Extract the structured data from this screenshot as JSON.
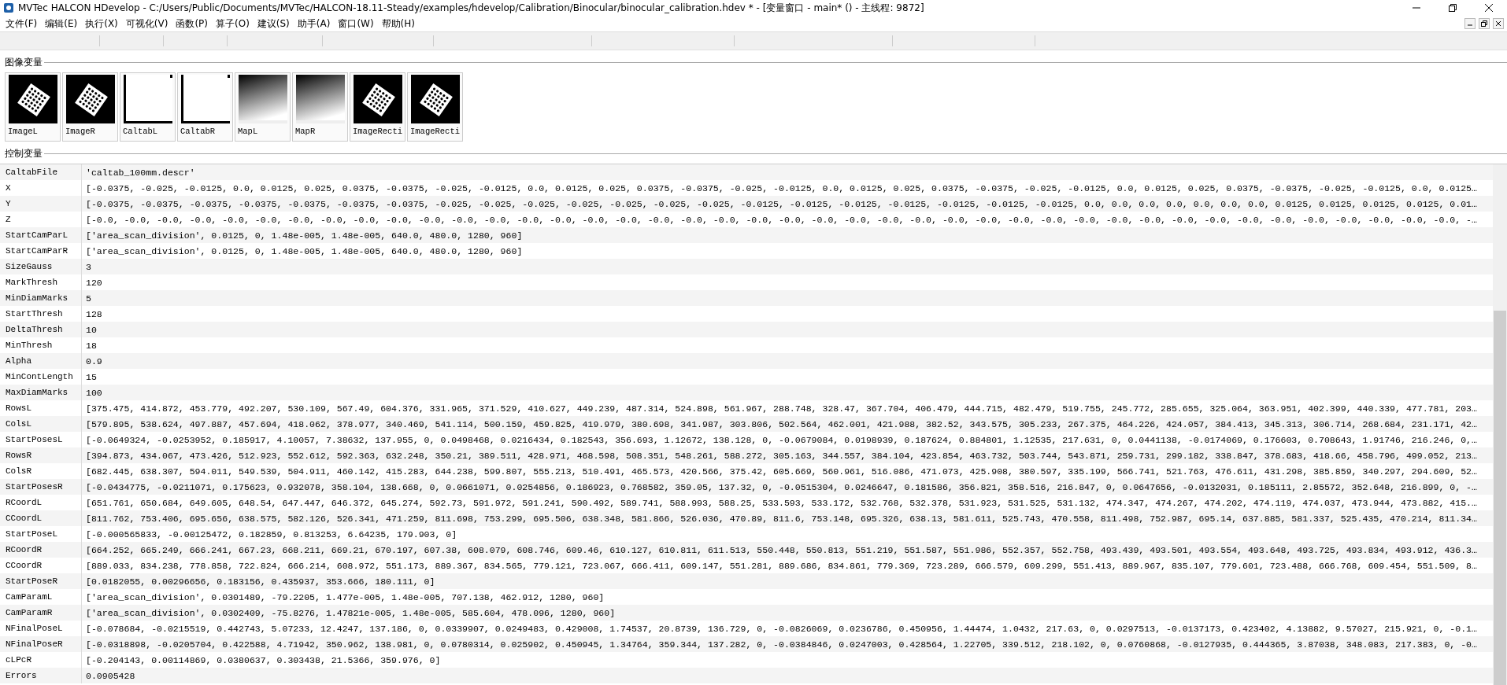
{
  "window": {
    "title": "MVTec HALCON HDevelop - C:/Users/Public/Documents/MVTec/HALCON-18.11-Steady/examples/hdevelop/Calibration/Binocular/binocular_calibration.hdev * - [变量窗口 - main* () - 主线程: 9872]"
  },
  "menu": [
    "文件(F)",
    "编辑(E)",
    "执行(X)",
    "可视化(V)",
    "函数(P)",
    "算子(O)",
    "建议(S)",
    "助手(A)",
    "窗口(W)",
    "帮助(H)"
  ],
  "image_variables": {
    "title": "图像变量",
    "items": [
      {
        "name": "ImageL",
        "kind": "plate"
      },
      {
        "name": "ImageR",
        "kind": "plate"
      },
      {
        "name": "CaltabL",
        "kind": "blank"
      },
      {
        "name": "CaltabR",
        "kind": "blank"
      },
      {
        "name": "MapL",
        "kind": "gradient"
      },
      {
        "name": "MapR",
        "kind": "gradient"
      },
      {
        "name": "ImageRecti",
        "kind": "plate"
      },
      {
        "name": "ImageRecti",
        "kind": "plate"
      }
    ]
  },
  "control_variables": {
    "title": "控制变量",
    "rows": [
      {
        "name": "CaltabFile",
        "value": "'caltab_100mm.descr'"
      },
      {
        "name": "X",
        "value": "[-0.0375, -0.025, -0.0125, 0.0, 0.0125, 0.025, 0.0375, -0.0375, -0.025, -0.0125, 0.0, 0.0125, 0.025, 0.0375, -0.0375, -0.025, -0.0125, 0.0, 0.0125, 0.025, 0.0375, -0.0375, -0.025, -0.0125, 0.0, 0.0125, 0.025, 0.0375, -0.0375, -0.025, -0.0125, 0.0, 0.0125…"
      },
      {
        "name": "Y",
        "value": "[-0.0375, -0.0375, -0.0375, -0.0375, -0.0375, -0.0375, -0.0375, -0.025, -0.025, -0.025, -0.025, -0.025, -0.025, -0.025, -0.0125, -0.0125, -0.0125, -0.0125, -0.0125, -0.0125, -0.0125, 0.0, 0.0, 0.0, 0.0, 0.0, 0.0, 0.0, 0.0125, 0.0125, 0.0125, 0.0125, 0.01…"
      },
      {
        "name": "Z",
        "value": "[-0.0, -0.0, -0.0, -0.0, -0.0, -0.0, -0.0, -0.0, -0.0, -0.0, -0.0, -0.0, -0.0, -0.0, -0.0, -0.0, -0.0, -0.0, -0.0, -0.0, -0.0, -0.0, -0.0, -0.0, -0.0, -0.0, -0.0, -0.0, -0.0, -0.0, -0.0, -0.0, -0.0, -0.0, -0.0, -0.0, -0.0, -0.0, -0.0, -0.0, -0.0, -0.0, -…"
      },
      {
        "name": "StartCamParL",
        "value": "['area_scan_division', 0.0125, 0, 1.48e-005, 1.48e-005, 640.0, 480.0, 1280, 960]"
      },
      {
        "name": "StartCamParR",
        "value": "['area_scan_division', 0.0125, 0, 1.48e-005, 1.48e-005, 640.0, 480.0, 1280, 960]"
      },
      {
        "name": "SizeGauss",
        "value": "3"
      },
      {
        "name": "MarkThresh",
        "value": "120"
      },
      {
        "name": "MinDiamMarks",
        "value": "5"
      },
      {
        "name": "StartThresh",
        "value": "128"
      },
      {
        "name": "DeltaThresh",
        "value": "10"
      },
      {
        "name": "MinThresh",
        "value": "18"
      },
      {
        "name": "Alpha",
        "value": "0.9"
      },
      {
        "name": "MinContLength",
        "value": "15"
      },
      {
        "name": "MaxDiamMarks",
        "value": "100"
      },
      {
        "name": "RowsL",
        "value": "[375.475, 414.872, 453.779, 492.207, 530.109, 567.49, 604.376, 331.965, 371.529, 410.627, 449.239, 487.314, 524.898, 561.967, 288.748, 328.47, 367.704, 406.479, 444.715, 482.479, 519.755, 245.772, 285.655, 325.064, 363.951, 402.399, 440.339, 477.781, 203…"
      },
      {
        "name": "ColsL",
        "value": "[579.895, 538.624, 497.887, 457.694, 418.062, 378.977, 340.469, 541.114, 500.159, 459.825, 419.979, 380.698, 341.987, 303.806, 502.564, 462.001, 421.988, 382.52, 343.575, 305.233, 267.375, 464.226, 424.057, 384.413, 345.313, 306.714, 268.684, 231.171, 42…"
      },
      {
        "name": "StartPosesL",
        "value": "[-0.0649324, -0.0253952, 0.185917, 4.10057, 7.38632, 137.955, 0, 0.0498468, 0.0216434, 0.182543, 356.693, 1.12672, 138.128, 0, -0.0679084, 0.0198939, 0.187624, 0.884801, 1.12535, 217.631, 0, 0.0441138, -0.0174069, 0.176603, 0.708643, 1.91746, 216.246, 0,…"
      },
      {
        "name": "RowsR",
        "value": "[394.873, 434.067, 473.426, 512.923, 552.612, 592.363, 632.248, 350.21, 389.511, 428.971, 468.598, 508.351, 548.261, 588.272, 305.163, 344.557, 384.104, 423.854, 463.732, 503.744, 543.871, 259.731, 299.182, 338.847, 378.683, 418.66, 458.796, 499.052, 213…"
      },
      {
        "name": "ColsR",
        "value": "[682.445, 638.307, 594.011, 549.539, 504.911, 460.142, 415.283, 644.238, 599.807, 555.213, 510.491, 465.573, 420.566, 375.42, 605.669, 560.961, 516.086, 471.073, 425.908, 380.597, 335.199, 566.741, 521.763, 476.611, 431.298, 385.859, 340.297, 294.609, 52…"
      },
      {
        "name": "StartPosesR",
        "value": "[-0.0434775, -0.0211071, 0.175623, 0.932078, 358.104, 138.668, 0, 0.0661071, 0.0254856, 0.186923, 0.768582, 359.05, 137.32, 0, -0.0515304, 0.0246647, 0.181586, 356.821, 358.516, 216.847, 0, 0.0647656, -0.0132031, 0.185111, 2.85572, 352.648, 216.899, 0, -…"
      },
      {
        "name": "RCoordL",
        "value": "[651.761, 650.684, 649.605, 648.54, 647.447, 646.372, 645.274, 592.73, 591.972, 591.241, 590.492, 589.741, 588.993, 588.25, 533.593, 533.172, 532.768, 532.378, 531.923, 531.525, 531.132, 474.347, 474.267, 474.202, 474.119, 474.037, 473.944, 473.882, 415.…"
      },
      {
        "name": "CCoordL",
        "value": "[811.762, 753.406, 695.656, 638.575, 582.126, 526.341, 471.259, 811.698, 753.299, 695.506, 638.348, 581.866, 526.036, 470.89, 811.6, 753.148, 695.326, 638.13, 581.611, 525.743, 470.558, 811.498, 752.987, 695.14, 637.885, 581.337, 525.435, 470.214, 811.34…"
      },
      {
        "name": "StartPoseL",
        "value": "[-0.000565833, -0.00125472, 0.182859, 0.813253, 6.64235, 179.903, 0]"
      },
      {
        "name": "RCoordR",
        "value": "[664.252, 665.249, 666.241, 667.23, 668.211, 669.21, 670.197, 607.38, 608.079, 608.746, 609.46, 610.127, 610.811, 611.513, 550.448, 550.813, 551.219, 551.587, 551.986, 552.357, 552.758, 493.439, 493.501, 493.554, 493.648, 493.725, 493.834, 493.912, 436.3…"
      },
      {
        "name": "CCoordR",
        "value": "[889.033, 834.238, 778.858, 722.824, 666.214, 608.972, 551.173, 889.367, 834.565, 779.121, 723.067, 666.411, 609.147, 551.281, 889.686, 834.861, 779.369, 723.289, 666.579, 609.299, 551.413, 889.967, 835.107, 779.601, 723.488, 666.768, 609.454, 551.509, 8…"
      },
      {
        "name": "StartPoseR",
        "value": "[0.0182055, 0.00296656, 0.183156, 0.435937, 353.666, 180.111, 0]"
      },
      {
        "name": "CamParamL",
        "value": "['area_scan_division', 0.0301489, -79.2205, 1.477e-005, 1.48e-005, 707.138, 462.912, 1280, 960]"
      },
      {
        "name": "CamParamR",
        "value": "['area_scan_division', 0.0302409, -75.8276, 1.47821e-005, 1.48e-005, 585.604, 478.096, 1280, 960]"
      },
      {
        "name": "NFinalPoseL",
        "value": "[-0.078684, -0.0215519, 0.442743, 5.07233, 12.4247, 137.186, 0, 0.0339907, 0.0249483, 0.429008, 1.74537, 20.8739, 136.729, 0, -0.0826069, 0.0236786, 0.450956, 1.44474, 1.0432, 217.63, 0, 0.0297513, -0.0137173, 0.423402, 4.13882, 9.57027, 215.921, 0, -0.1…"
      },
      {
        "name": "NFinalPoseR",
        "value": "[-0.0318898, -0.0205704, 0.422588, 4.71942, 350.962, 138.981, 0, 0.0780314, 0.025902, 0.450945, 1.34764, 359.344, 137.282, 0, -0.0384846, 0.0247003, 0.428564, 1.22705, 339.512, 218.102, 0, 0.0760868, -0.0127935, 0.444365, 3.87038, 348.083, 217.383, 0, -0…"
      },
      {
        "name": "cLPcR",
        "value": "[-0.204143, 0.00114869, 0.0380637, 0.303438, 21.5366, 359.976, 0]"
      },
      {
        "name": "Errors",
        "value": "0.0905428"
      }
    ]
  }
}
